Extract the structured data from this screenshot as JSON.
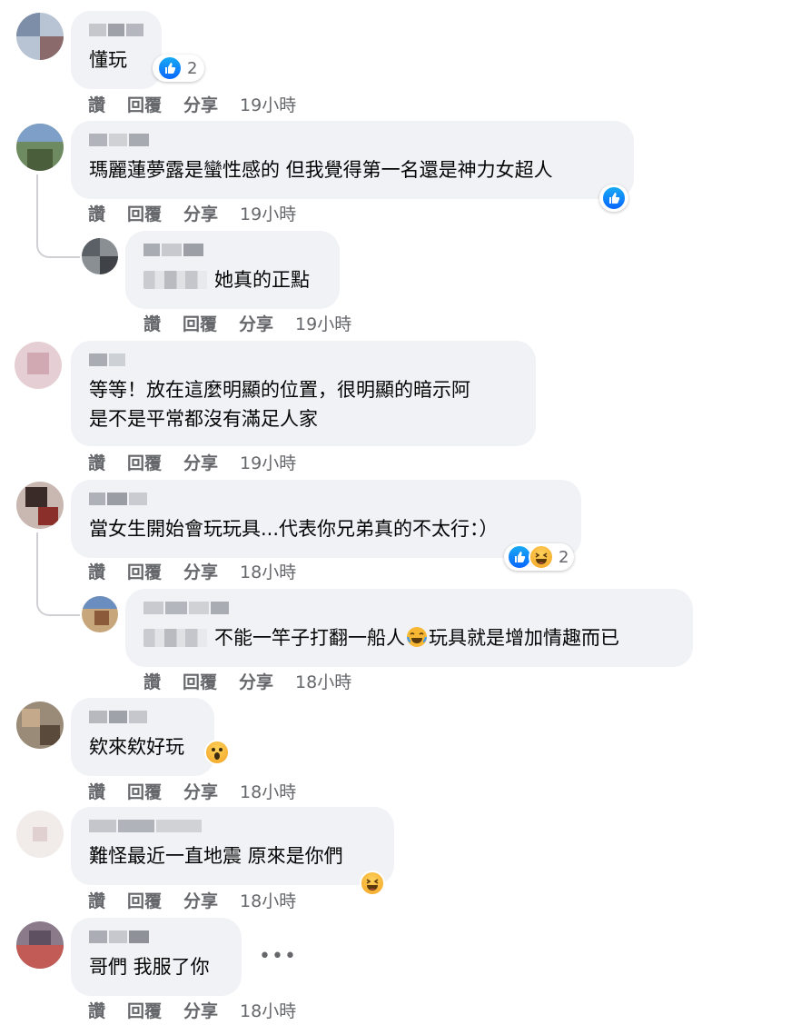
{
  "comments": [
    {
      "text": "懂玩",
      "actions": {
        "like": "讚",
        "reply": "回覆",
        "share": "分享",
        "time": "19小時"
      },
      "reaction_count": "2"
    },
    {
      "text": "瑪麗蓮夢露是蠻性感的 但我覺得第一名還是神力女超人",
      "actions": {
        "like": "讚",
        "reply": "回覆",
        "share": "分享",
        "time": "19小時"
      }
    },
    {
      "text": "她真的正點",
      "actions": {
        "like": "讚",
        "reply": "回覆",
        "share": "分享",
        "time": "19小時"
      }
    },
    {
      "text_line1": "等等！放在這麼明顯的位置，很明顯的暗示阿",
      "text_line2": "是不是平常都沒有滿足人家",
      "actions": {
        "like": "讚",
        "reply": "回覆",
        "share": "分享",
        "time": "19小時"
      }
    },
    {
      "text": "當女生開始會玩玩具...代表你兄弟真的不太行：）",
      "actions": {
        "like": "讚",
        "reply": "回覆",
        "share": "分享",
        "time": "18小時"
      },
      "reaction_count": "2"
    },
    {
      "text_before": "不能一竿子打翻一船人",
      "text_after": "玩具就是增加情趣而已",
      "actions": {
        "like": "讚",
        "reply": "回覆",
        "share": "分享",
        "time": "18小時"
      }
    },
    {
      "text": "欸來欸好玩",
      "actions": {
        "like": "讚",
        "reply": "回覆",
        "share": "分享",
        "time": "18小時"
      }
    },
    {
      "text": "難怪最近一直地震 原來是你們",
      "actions": {
        "like": "讚",
        "reply": "回覆",
        "share": "分享",
        "time": "18小時"
      }
    },
    {
      "text": "哥們 我服了你",
      "actions": {
        "like": "讚",
        "reply": "回覆",
        "share": "分享",
        "time": "18小時"
      },
      "more": "•••"
    }
  ],
  "icons": {
    "like": "like-icon",
    "haha": "haha-icon",
    "wow": "wow-icon",
    "cry_laugh": "cry-laugh-icon"
  },
  "colors": {
    "bubble": "#f0f2f5",
    "secondary_text": "#65676b",
    "like_blue": "#0866ff"
  }
}
